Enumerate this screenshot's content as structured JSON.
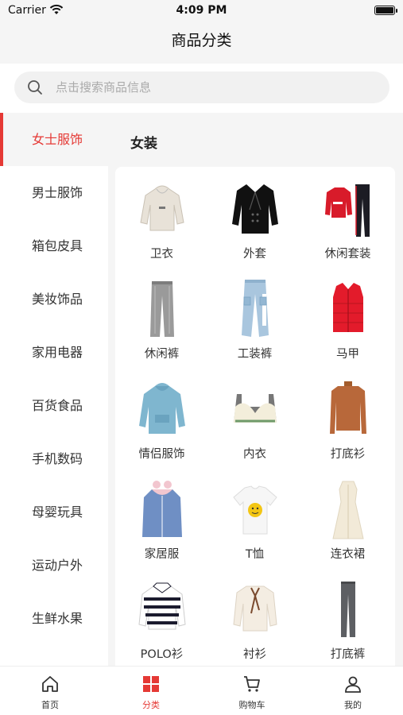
{
  "status_bar": {
    "carrier": "Carrier",
    "time": "4:09 PM"
  },
  "nav": {
    "title": "商品分类"
  },
  "search": {
    "placeholder": "点击搜索商品信息"
  },
  "sidebar": {
    "items": [
      {
        "label": "女士服饰",
        "active": true
      },
      {
        "label": "男士服饰"
      },
      {
        "label": "箱包皮具"
      },
      {
        "label": "美妆饰品"
      },
      {
        "label": "家用电器"
      },
      {
        "label": "百货食品"
      },
      {
        "label": "手机数码"
      },
      {
        "label": "母婴玩具"
      },
      {
        "label": "运动户外"
      },
      {
        "label": "生鲜水果"
      }
    ]
  },
  "category": {
    "title": "女装"
  },
  "products": [
    {
      "label": "卫衣",
      "icon": "hoodie-icon"
    },
    {
      "label": "外套",
      "icon": "coat-icon"
    },
    {
      "label": "休闲套装",
      "icon": "casual-set-icon"
    },
    {
      "label": "休闲裤",
      "icon": "casual-pants-icon"
    },
    {
      "label": "工装裤",
      "icon": "cargo-pants-icon"
    },
    {
      "label": "马甲",
      "icon": "vest-icon"
    },
    {
      "label": "情侣服饰",
      "icon": "couple-hoodie-icon"
    },
    {
      "label": "内衣",
      "icon": "bra-icon"
    },
    {
      "label": "打底衫",
      "icon": "base-shirt-icon"
    },
    {
      "label": "家居服",
      "icon": "homewear-icon"
    },
    {
      "label": "T恤",
      "icon": "tshirt-icon"
    },
    {
      "label": "连衣裙",
      "icon": "dress-icon"
    },
    {
      "label": "POLO衫",
      "icon": "polo-icon"
    },
    {
      "label": "衬衫",
      "icon": "blouse-icon"
    },
    {
      "label": "打底裤",
      "icon": "leggings-icon"
    }
  ],
  "tab_bar": {
    "tabs": [
      {
        "label": "首页",
        "icon": "home-icon"
      },
      {
        "label": "分类",
        "icon": "category-icon",
        "active": true
      },
      {
        "label": "购物车",
        "icon": "cart-icon"
      },
      {
        "label": "我的",
        "icon": "user-icon"
      }
    ]
  },
  "colors": {
    "accent": "#e53935",
    "background": "#f5f5f5"
  }
}
